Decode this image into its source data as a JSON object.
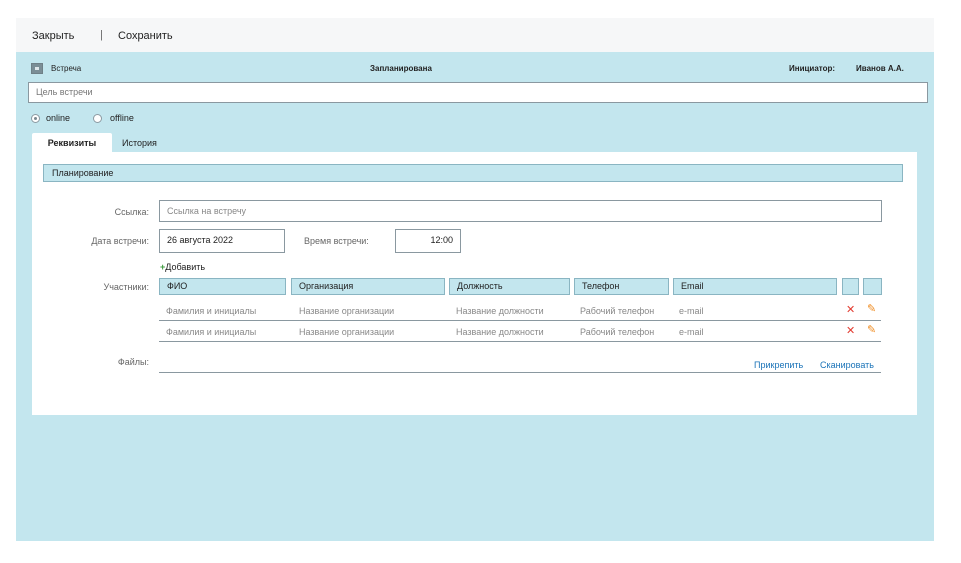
{
  "toolbar": {
    "close_label": "Закрыть",
    "separator": "|",
    "save_label": "Сохранить"
  },
  "header": {
    "type_label": "Встреча",
    "status": "Запланирована",
    "initiator_label": "Инициатор:",
    "initiator_name": "Иванов А.А."
  },
  "goal": {
    "placeholder": "Цель встречи"
  },
  "mode": {
    "options": [
      "online",
      "offline"
    ],
    "selected": "online"
  },
  "tabs": [
    {
      "label": "Реквизиты",
      "active": true
    },
    {
      "label": "История",
      "active": false
    }
  ],
  "planning": {
    "section_title": "Планирование",
    "link_label": "Ссылка:",
    "link_placeholder": "Ссылка на встречу",
    "date_label": "Дата встречи:",
    "date_value": "26 августа 2022",
    "time_label": "Время встречи:",
    "time_value": "12:00",
    "participants_label": "Участники:",
    "add_label": "Добавить",
    "columns": [
      "ФИО",
      "Организация",
      "Должность",
      "Телефон",
      "Email"
    ],
    "rows": [
      [
        "Фамилия  и инициалы",
        "Название организации",
        "Название должности",
        "Рабочий телефон",
        "e-mail"
      ],
      [
        "Фамилия  и инициалы",
        "Название организации",
        "Название должности",
        "Рабочий телефон",
        "e-mail"
      ]
    ],
    "files_label": "Файлы:",
    "attach_label": "Прикрепить",
    "scan_label": "Сканировать"
  },
  "icons": {
    "delete": "delete-icon",
    "edit": "pencil-icon",
    "add": "plus-icon",
    "type": "meeting-icon"
  },
  "colors": {
    "panel": "#c3e6ee",
    "delete": "#e23b30",
    "edit": "#ef8a1e",
    "link": "#1a73b8",
    "add": "#3c9a3c"
  }
}
